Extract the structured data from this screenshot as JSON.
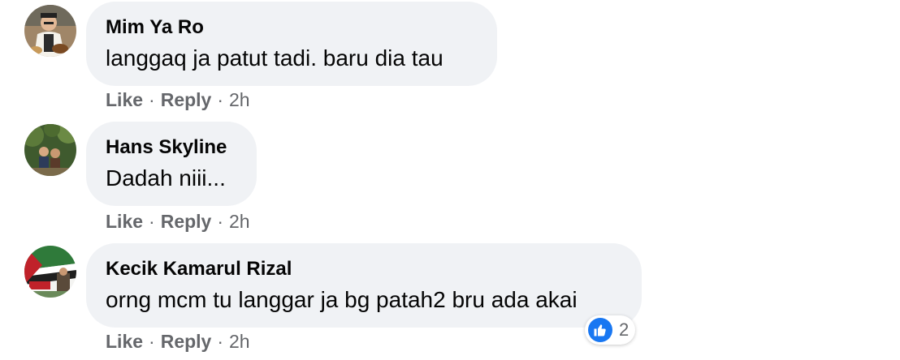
{
  "comments": [
    {
      "author": "Mim Ya Ro",
      "text": "langgaq ja patut tadi. baru dia tau",
      "like_label": "Like",
      "reply_label": "Reply",
      "separator": "·",
      "time": "2h"
    },
    {
      "author": "Hans Skyline",
      "text": "Dadah niii...",
      "like_label": "Like",
      "reply_label": "Reply",
      "separator": "·",
      "time": "2h"
    },
    {
      "author": "Kecik Kamarul Rizal",
      "text": "orng mcm tu langgar ja bg patah2 bru ada akai",
      "like_label": "Like",
      "reply_label": "Reply",
      "separator": "·",
      "time": "2h",
      "reaction_count": "2",
      "reaction_icon": "thumbs-up-icon"
    }
  ],
  "colors": {
    "bubble": "#f0f2f5",
    "text": "#050505",
    "meta": "#65676b",
    "like_blue": "#1877f2"
  }
}
